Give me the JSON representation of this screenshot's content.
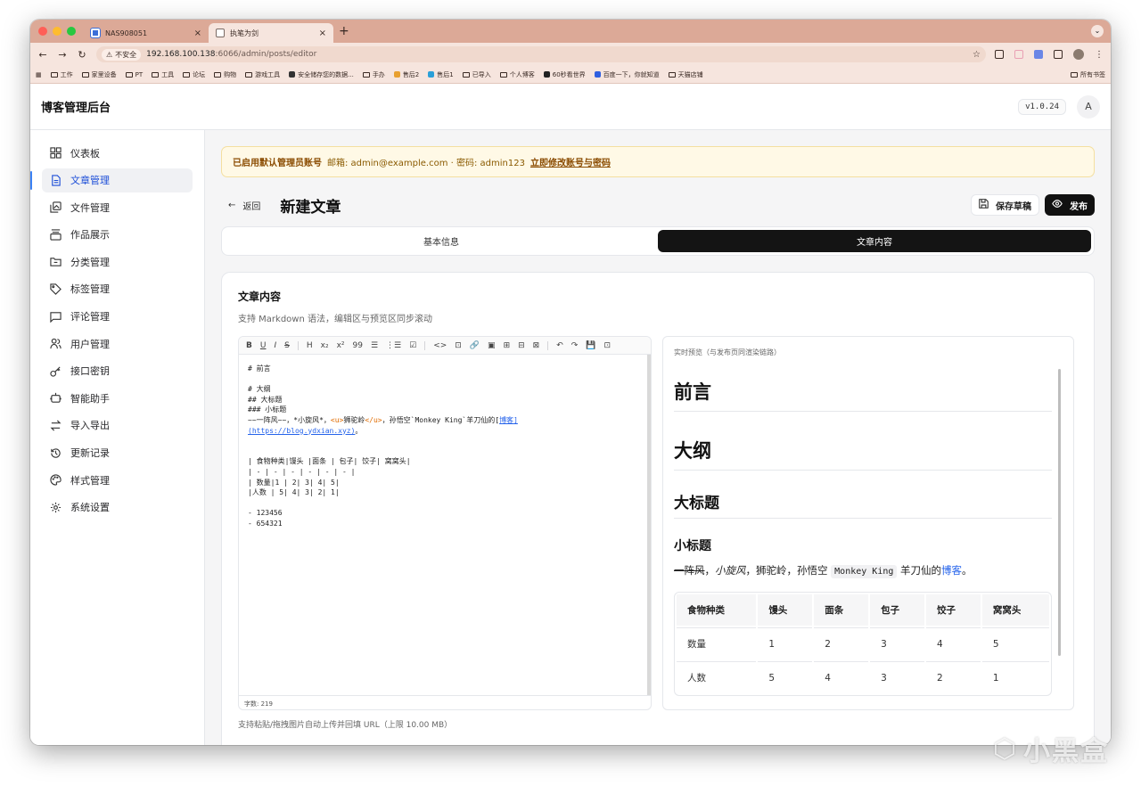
{
  "browser": {
    "tabs": [
      {
        "title": "NAS908051",
        "close": "×"
      },
      {
        "title": "执笔为剑",
        "close": "×"
      }
    ],
    "new_tab": "+",
    "address": {
      "security": "不安全",
      "host": "192.168.100.138",
      "path": ":6066/admin/posts/editor"
    },
    "bookmarks": [
      "工作",
      "家里设备",
      "PT",
      "工具",
      "论坛",
      "购物",
      "游戏工具",
      "安全储存您的数据...",
      "手办",
      "售后2",
      "售后1",
      "已导入",
      "个人博客",
      "60秒看世界",
      "百度一下，你就知道",
      "天猫店铺"
    ],
    "bookmarks_right": "所有书签"
  },
  "app": {
    "brand": "博客管理后台",
    "version": "v1.0.24",
    "avatar": "A"
  },
  "sidebar": {
    "items": [
      {
        "label": "仪表板",
        "icon": "dashboard-icon"
      },
      {
        "label": "文章管理",
        "icon": "file-text-icon",
        "active": true
      },
      {
        "label": "文件管理",
        "icon": "images-icon"
      },
      {
        "label": "作品展示",
        "icon": "showcase-icon"
      },
      {
        "label": "分类管理",
        "icon": "folder-icon"
      },
      {
        "label": "标签管理",
        "icon": "tag-icon"
      },
      {
        "label": "评论管理",
        "icon": "comment-icon"
      },
      {
        "label": "用户管理",
        "icon": "users-icon"
      },
      {
        "label": "接口密钥",
        "icon": "key-icon"
      },
      {
        "label": "智能助手",
        "icon": "bot-icon"
      },
      {
        "label": "导入导出",
        "icon": "transfer-icon"
      },
      {
        "label": "更新记录",
        "icon": "history-icon"
      },
      {
        "label": "样式管理",
        "icon": "palette-icon"
      },
      {
        "label": "系统设置",
        "icon": "settings-icon"
      }
    ]
  },
  "alert": {
    "title": "已启用默认管理员账号",
    "text": "邮箱: admin@example.com · 密码: admin123",
    "link": "立即修改账号与密码"
  },
  "page": {
    "back": "返回",
    "title": "新建文章",
    "save_draft": "保存草稿",
    "publish": "发布",
    "tabs": [
      "基本信息",
      "文章内容"
    ],
    "active_tab": 1
  },
  "content_card": {
    "title": "文章内容",
    "subtitle": "支持 Markdown 语法，编辑区与预览区同步滚动",
    "upload_hint": "支持粘贴/拖拽图片自动上传并回填 URL（上限 10.00 MB）",
    "word_count": "字数: 219",
    "preview_label": "实时预览（与发布页同渲染链路）"
  },
  "editor": {
    "toolbar": [
      "B",
      "U",
      "I",
      "S",
      "H",
      "x₂",
      "x²",
      "99",
      "☰",
      "⋮☰",
      "☑",
      "<>",
      "⊡",
      "🔗",
      "▣",
      "⊞",
      "⊟",
      "⊠",
      "↶",
      "↷",
      "💾",
      "⊡"
    ],
    "lines": {
      "l1": "# 前言",
      "l2": "# 大纲",
      "l3": "## 大标题",
      "l4": "### 小标题",
      "l5a": "~~一阵风~~，*小旋风*，",
      "l5b": "<u>",
      "l5c": "狮驼岭",
      "l5d": "</u>",
      "l5e": "，孙悟空`Monkey King`羊刀仙的[",
      "l5f": "博客",
      "l5g": "]",
      "l6": "(https://blog.ydxian.xyz)",
      "l6b": "。",
      "t1": "| 食物种类|馒头 |面条 | 包子| 饺子| 窝窝头|",
      "t2": "| - | - | - | - | - | - |",
      "t3": "| 数量|1 | 2| 3| 4| 5|",
      "t4": "|人数 | 5| 4| 3| 2| 1|",
      "li1": "- 123456",
      "li2": "- 654321"
    }
  },
  "preview": {
    "h1a": "前言",
    "h1b": "大纲",
    "h2": "大标题",
    "h3": "小标题",
    "p_del": "一阵风",
    "p_sep1": "，",
    "p_em": "小旋风",
    "p_sep2": "，狮驼岭，孙悟空",
    "p_code": "Monkey King",
    "p_mid": "羊刀仙的",
    "p_link": "博客",
    "p_end": "。",
    "table": {
      "headers": [
        "食物种类",
        "馒头",
        "面条",
        "包子",
        "饺子",
        "窝窝头"
      ],
      "rows": [
        [
          "数量",
          "1",
          "2",
          "3",
          "4",
          "5"
        ],
        [
          "人数",
          "5",
          "4",
          "3",
          "2",
          "1"
        ]
      ]
    }
  },
  "watermark": "小黑盒"
}
